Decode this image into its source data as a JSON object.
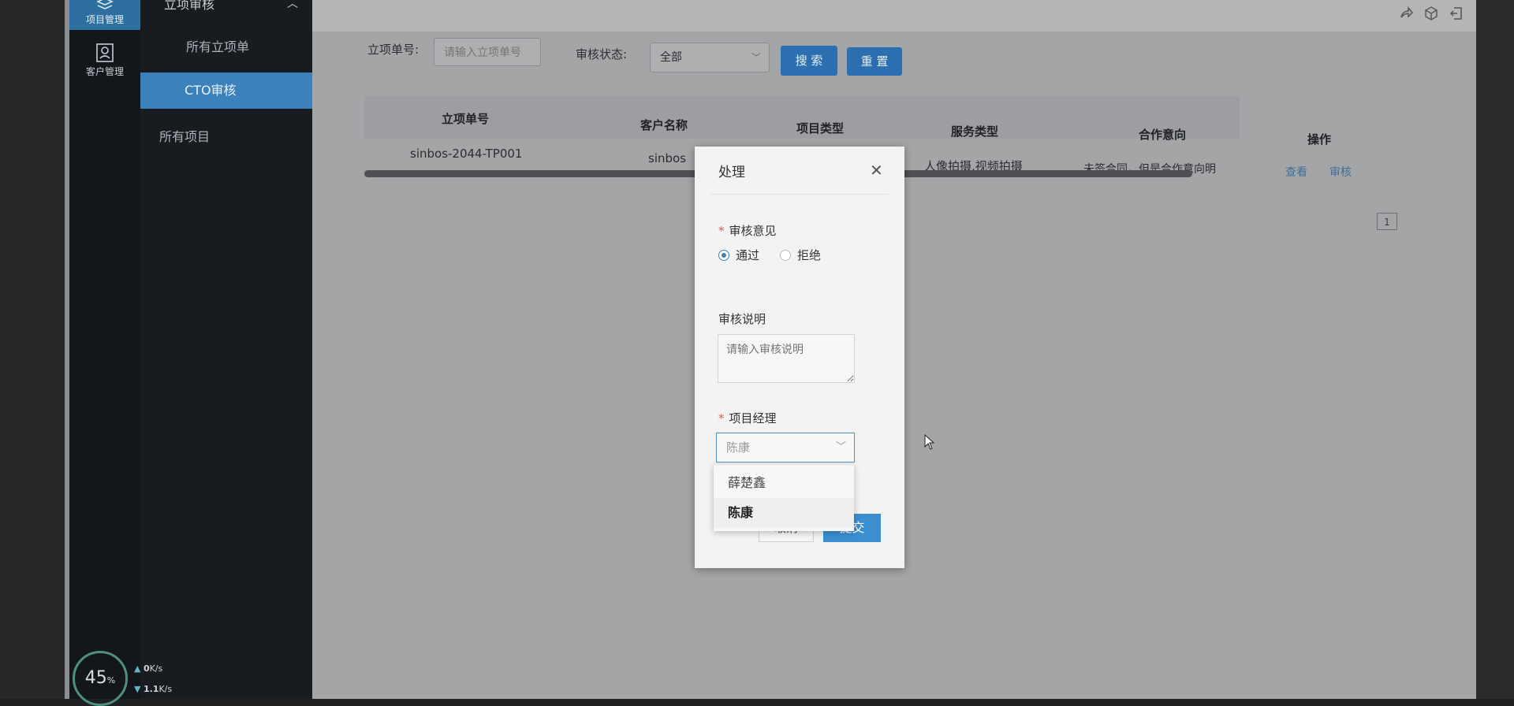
{
  "sidebar": {
    "rail": [
      {
        "label": "项目管理",
        "icon": "layers-icon",
        "active": true
      },
      {
        "label": "客户管理",
        "icon": "contact-icon",
        "active": false
      }
    ],
    "nav_group": "立项审核",
    "nav_items": [
      {
        "label": "所有立项单",
        "active": false
      },
      {
        "label": "CTO审核",
        "active": true
      },
      {
        "label": "所有项目",
        "active": false
      }
    ]
  },
  "system_monitor": {
    "percent": "45",
    "percent_unit": "%",
    "up_value": "0",
    "up_unit": "K/s",
    "down_value": "1.1",
    "down_unit": "K/s"
  },
  "filters": {
    "order_no_label": "立项单号:",
    "order_no_placeholder": "请输入立项单号",
    "status_label": "审核状态:",
    "status_value": "全部",
    "search_label": "搜 索",
    "reset_label": "重 置"
  },
  "table": {
    "columns": [
      "立项单号",
      "客户名称",
      "项目类型",
      "服务类型",
      "合作意向",
      "操作"
    ],
    "rows": [
      {
        "order_no": "sinbos-2044-TP001",
        "customer": "sinbos",
        "service_type": "人像拍摄,视频拍摄",
        "intent": "未签合同，但是合作意向明",
        "actions": [
          "查看",
          "审核"
        ]
      }
    ]
  },
  "pager": {
    "current_page": "1"
  },
  "modal": {
    "title": "处理",
    "opinion_label": "审核意见",
    "opinion_options": [
      {
        "label": "通过",
        "checked": true
      },
      {
        "label": "拒绝",
        "checked": false
      }
    ],
    "remark_label": "审核说明",
    "remark_placeholder": "请输入审核说明",
    "manager_label": "项目经理",
    "manager_value": "陈康",
    "manager_options": [
      {
        "label": "薛楚鑫",
        "selected": false
      },
      {
        "label": "陈康",
        "selected": true
      }
    ],
    "cancel_label": "取消",
    "submit_label": "提交"
  },
  "colors": {
    "primary": "#3b82bd",
    "sidebar_bg": "#181c21",
    "required": "#e25c5c"
  }
}
